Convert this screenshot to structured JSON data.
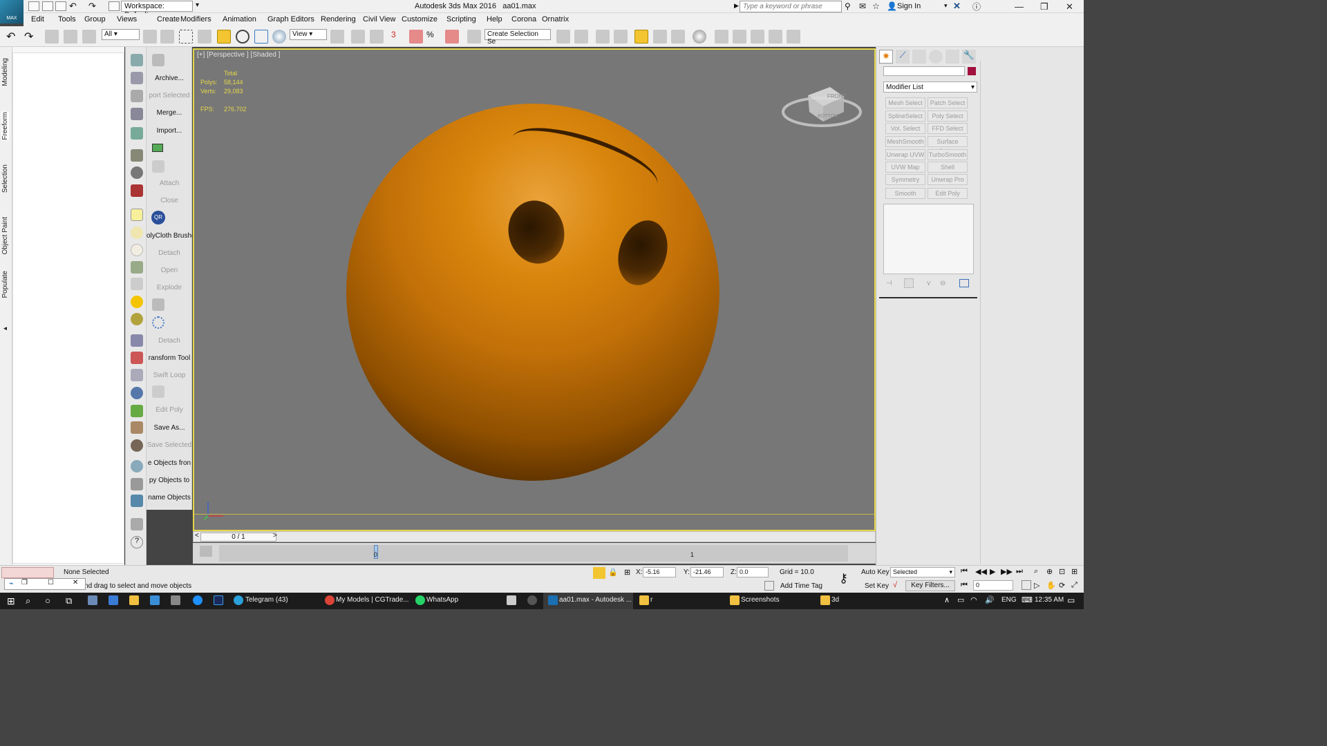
{
  "titlebar": {
    "workspace": "Workspace: Default",
    "app_title": "Autodesk 3ds Max 2016",
    "file_name": "aa01.max",
    "search_placeholder": "Type a keyword or phrase",
    "sign_in": "Sign In",
    "logo_text": "MAX"
  },
  "menu": [
    "Edit",
    "Tools",
    "Group",
    "Views",
    "Create",
    "Modifiers",
    "Animation",
    "Graph Editors",
    "Rendering",
    "Civil View",
    "Customize",
    "Scripting",
    "Help",
    "Corona",
    "Ornatrix"
  ],
  "toolbar": {
    "filter": "All",
    "ref_coord": "View",
    "selection_set": "Create Selection Se"
  },
  "ribbon_tabs": [
    "Modeling",
    "Freeform",
    "Selection",
    "Object Paint",
    "Populate"
  ],
  "tools": [
    {
      "label": "Archive...",
      "enabled": true
    },
    {
      "label": "port Selected",
      "enabled": false
    },
    {
      "label": "Merge...",
      "enabled": true
    },
    {
      "label": "Import...",
      "enabled": true
    },
    {
      "label": "Attach",
      "enabled": false
    },
    {
      "label": "Close",
      "enabled": false
    },
    {
      "label": "olyCloth Brushe",
      "enabled": true
    },
    {
      "label": "Detach",
      "enabled": false
    },
    {
      "label": "Open",
      "enabled": false
    },
    {
      "label": "Explode",
      "enabled": false
    },
    {
      "label": "Detach",
      "enabled": false
    },
    {
      "label": "ransform Tool",
      "enabled": true
    },
    {
      "label": "Swift Loop",
      "enabled": false
    },
    {
      "label": "Edit Poly",
      "enabled": false
    },
    {
      "label": "Save As...",
      "enabled": true
    },
    {
      "label": "Save Selected",
      "enabled": false
    },
    {
      "label": "e Objects fron",
      "enabled": true
    },
    {
      "label": "py Objects to",
      "enabled": true
    },
    {
      "label": "name Objects",
      "enabled": true
    }
  ],
  "viewport": {
    "label": "[+] [Perspective ] [Shaded ]",
    "stats": {
      "total_label": "Total",
      "polys_label": "Polys:",
      "polys": "58,144",
      "verts_label": "Verts:",
      "verts": "29,083",
      "fps_label": "FPS:",
      "fps": "276.702"
    },
    "viewcube_front": "FRONT",
    "viewcube_bottom": "BOTTOM",
    "object_color": "#d9860d"
  },
  "timeline": {
    "frame_display": "0 / 1",
    "tick_0": "0",
    "tick_1": "1"
  },
  "command_panel": {
    "modifier_list": "Modifier List",
    "modifiers": [
      "Mesh Select",
      "Patch Select",
      "SplineSelect",
      "Poly Select",
      "Vol. Select",
      "FFD Select",
      "MeshSmooth",
      "Surface Select",
      "Unwrap UVW",
      "TurboSmooth",
      "UVW Map",
      "Shell",
      "Symmetry",
      "Unwrap Pro",
      "Smooth",
      "Edit Poly"
    ],
    "swatch_color": "#a1103e"
  },
  "status": {
    "selection": "None Selected",
    "prompt": "Click and drag to select and move objects",
    "x_label": "X:",
    "x": "-5.16",
    "y_label": "Y:",
    "y": "-21.46",
    "z_label": "Z:",
    "z": "0.0",
    "grid": "Grid = 10.0",
    "add_time_tag": "Add Time Tag",
    "auto_key": "Auto Key",
    "set_key": "Set Key",
    "key_mode": "Selected",
    "key_filters": "Key Filters...",
    "current_frame": "0"
  },
  "taskbar": {
    "items": [
      "Telegram (43)",
      "My Models | CGTrade...",
      "WhatsApp",
      "aa01.max - Autodesk ...",
      "r",
      "Screenshots",
      "3d"
    ],
    "lang": "ENG",
    "time": "12:35 AM"
  }
}
